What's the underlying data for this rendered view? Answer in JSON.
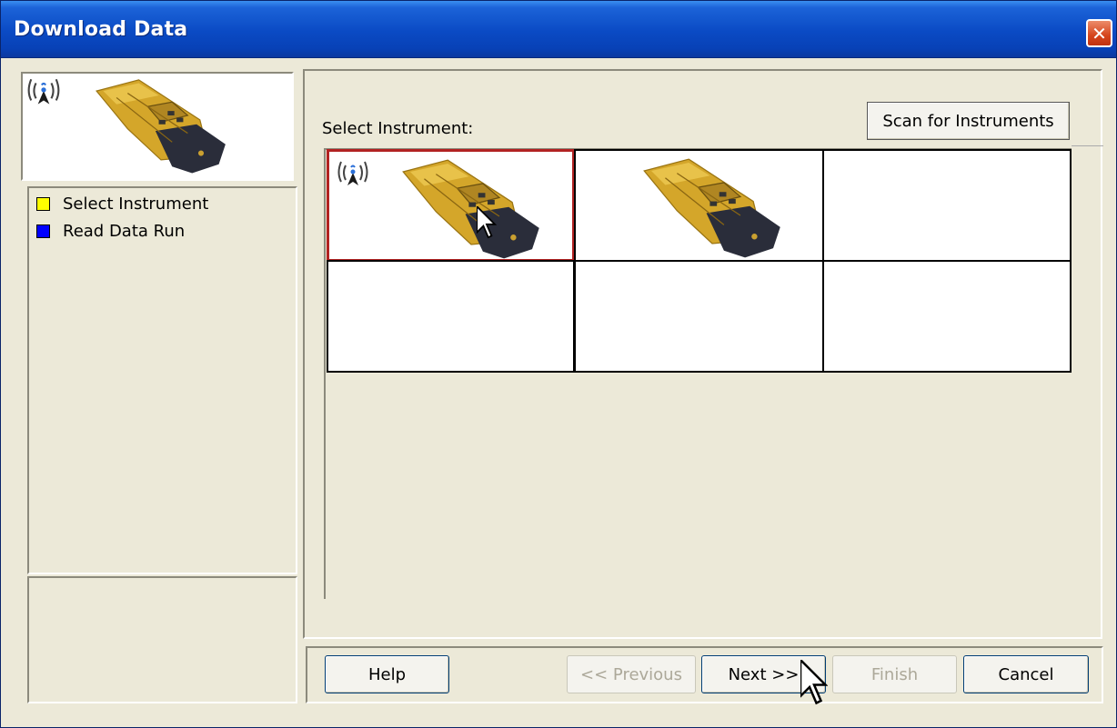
{
  "window": {
    "title": "Download Data",
    "close_glyph": "✕"
  },
  "steps": [
    {
      "label": "Select Instrument",
      "color": "#ffff00"
    },
    {
      "label": "Read Data Run",
      "color": "#0000ff"
    }
  ],
  "main": {
    "select_label": "Select Instrument:",
    "scan_button": "Scan for Instruments",
    "grid_cells": [
      {
        "has_instrument": true,
        "wireless": true,
        "selected": true
      },
      {
        "has_instrument": true,
        "wireless": false,
        "selected": false
      },
      {
        "has_instrument": false
      },
      {
        "has_instrument": false
      },
      {
        "has_instrument": false
      },
      {
        "has_instrument": false
      }
    ]
  },
  "buttons": {
    "help": "Help",
    "previous": "<< Previous",
    "next": "Next >>",
    "finish": "Finish",
    "cancel": "Cancel"
  },
  "colors": {
    "title_bar": "#0a4ac4",
    "selected_border": "#b22222",
    "instrument_gold": "#d4a62a",
    "instrument_dark": "#2a2d3a"
  },
  "icons": {
    "wireless": "wireless-signal-icon",
    "instrument": "instrument-device-icon",
    "close": "close-icon"
  }
}
